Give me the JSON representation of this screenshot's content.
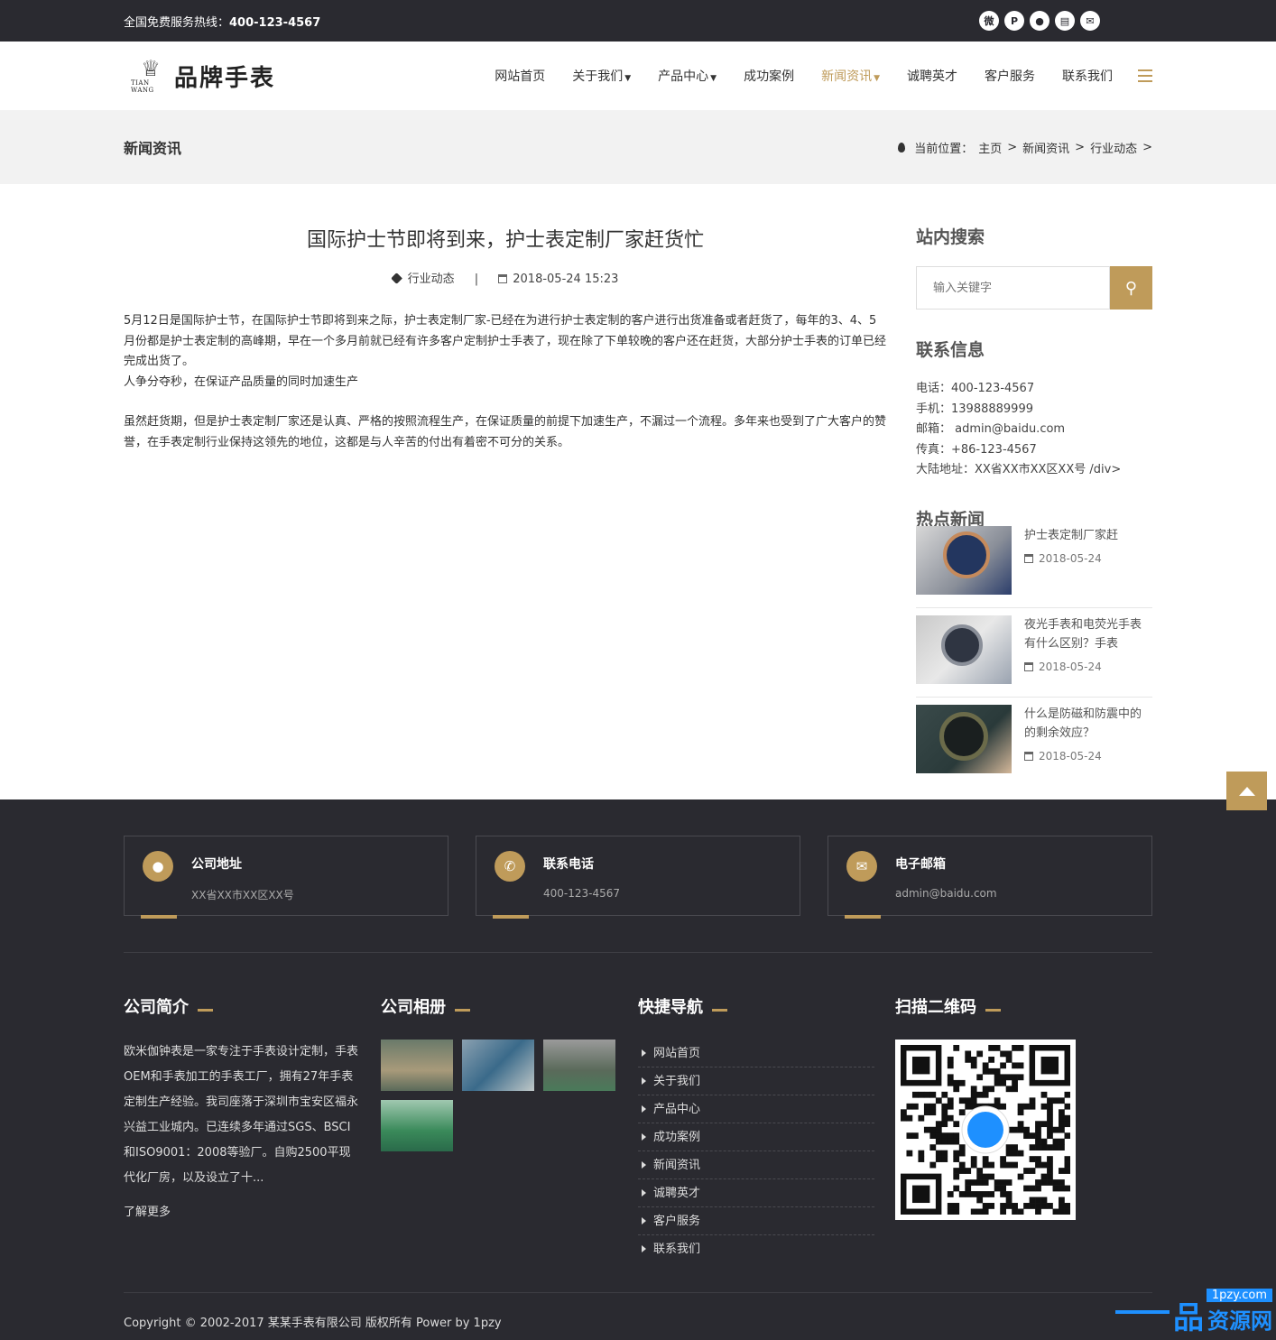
{
  "topbar": {
    "hotline_label": "全国免费服务热线：",
    "hotline_number": "400-123-4567",
    "icons": [
      "weibo-icon",
      "pinterest-icon",
      "qq-icon",
      "cart-icon",
      "mail-icon"
    ]
  },
  "header": {
    "logo_text": "品牌手表",
    "logo_sub": "TIAN WANG",
    "nav": [
      {
        "label": "网站首页"
      },
      {
        "label": "关于我们"
      },
      {
        "label": "产品中心"
      },
      {
        "label": "成功案例"
      },
      {
        "label": "新闻资讯"
      },
      {
        "label": "诚聘英才"
      },
      {
        "label": "客户服务"
      },
      {
        "label": "联系我们"
      }
    ],
    "active_color": "#bf9b5a"
  },
  "pagebar": {
    "title": "新闻资讯",
    "crumb_label": "当前位置：",
    "crumbs": [
      "主页",
      "新闻资讯",
      "行业动态"
    ]
  },
  "article": {
    "title": "国际护士节即将到来，护士表定制厂家赶货忙",
    "category": "行业动态",
    "date": "2018-05-24 15:23",
    "p1": "5月12日是国际护士节，在国际护士节即将到来之际，护士表定制厂家-已经在为进行护士表定制的客户进行出货准备或者赶货了，每年的3、4、5月份都是护士表定制的高峰期，早在一个多月前就已经有许多客户定制护士手表了，现在除了下单较晚的客户还在赶货，大部分护士手表的订单已经完成出货了。",
    "p2": "人争分夺秒，在保证产品质量的同时加速生产",
    "p3": "虽然赶货期，但是护士表定制厂家还是认真、严格的按照流程生产，在保证质量的前提下加速生产，不漏过一个流程。多年来也受到了广大客户的赞誉，在手表定制行业保持这领先的地位，这都是与人辛苦的付出有着密不可分的关系。"
  },
  "sidebar": {
    "search_title": "站内搜索",
    "search_placeholder": "输入关键字",
    "contact_title": "联系信息",
    "contact": [
      "电话：400-123-4567",
      "手机：13988889999",
      "邮箱： admin@baidu.com",
      "传真：+86-123-4567",
      "大陆地址：XX省XX市XX区XX号 /div>"
    ],
    "hot_title": "热点新闻",
    "hot": [
      {
        "title": "护士表定制厂家赶",
        "date": "2018-05-24"
      },
      {
        "title": "夜光手表和电荧光手表有什么区别？手表",
        "date": "2018-05-24"
      },
      {
        "title": "什么是防磁和防震中的的剩余效应？",
        "date": "2018-05-24"
      }
    ]
  },
  "footer": {
    "cards": [
      {
        "title": "公司地址",
        "value": "XX省XX市XX区XX号"
      },
      {
        "title": "联系电话",
        "value": "400-123-4567"
      },
      {
        "title": "电子邮箱",
        "value": "admin@baidu.com"
      }
    ],
    "intro_title": "公司简介",
    "intro_text": "欧米伽钟表是一家专注于手表设计定制，手表OEM和手表加工的手表工厂，拥有27年手表定制生产经验。我司座落于深圳市宝安区福永兴益工业城内。已连续多年通过SGS、BSCI和ISO9001：2008等验厂。自购2500平现代化厂房，以及设立了十...",
    "more": "了解更多",
    "album_title": "公司相册",
    "nav_title": "快捷导航",
    "nav": [
      "网站首页",
      "关于我们",
      "产品中心",
      "成功案例",
      "新闻资讯",
      "诚聘英才",
      "客户服务",
      "联系我们"
    ],
    "qr_title": "扫描二维码",
    "copyright": "Copyright © 2002-2017 某某手表有限公司 版权所有 Power by 1pzy"
  },
  "watermark": {
    "top": "1pzy.com",
    "mark": "品",
    "text": "资源网"
  }
}
